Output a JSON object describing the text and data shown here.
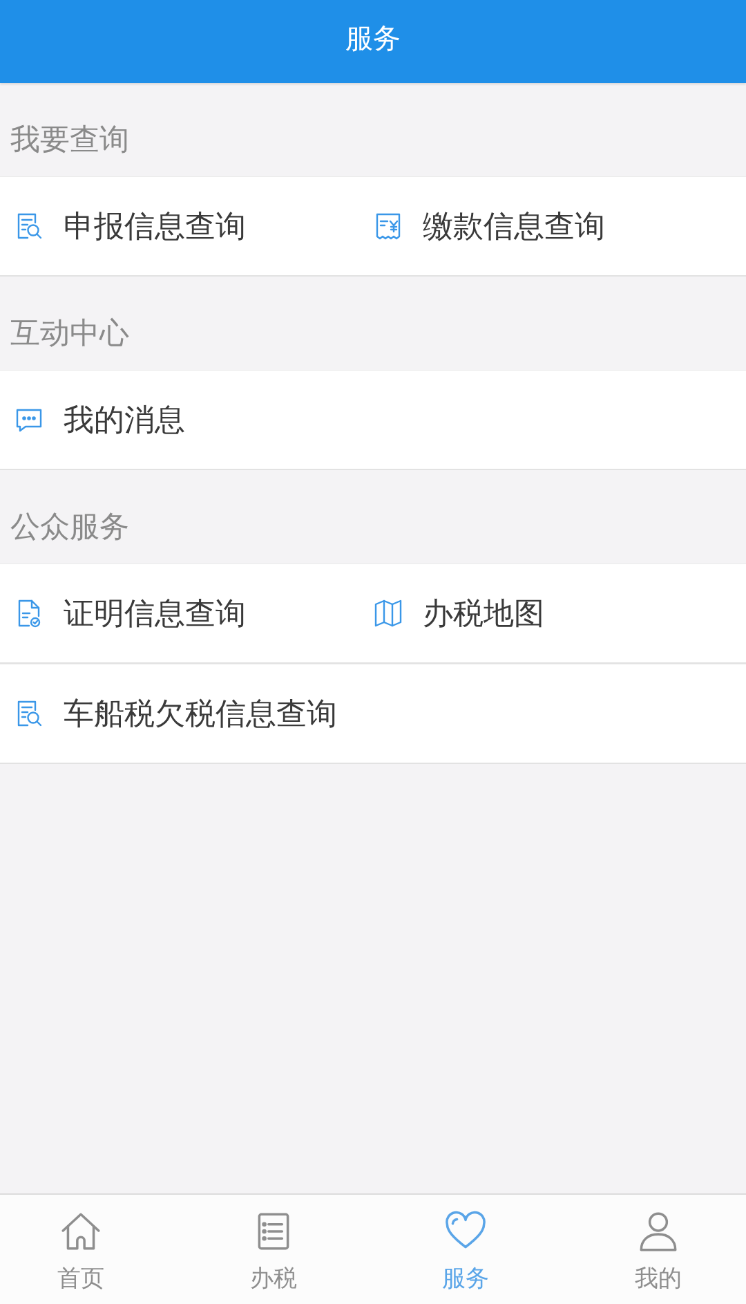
{
  "header": {
    "title": "服务"
  },
  "sections": [
    {
      "title": "我要查询",
      "rows": [
        {
          "items": [
            {
              "kind": "query",
              "label": "申报信息查询"
            },
            {
              "kind": "payment",
              "label": "缴款信息查询"
            }
          ]
        }
      ]
    },
    {
      "title": "互动中心",
      "rows": [
        {
          "items": [
            {
              "kind": "message",
              "label": "我的消息"
            }
          ]
        }
      ]
    },
    {
      "title": "公众服务",
      "rows": [
        {
          "items": [
            {
              "kind": "certificate",
              "label": "证明信息查询"
            },
            {
              "kind": "map",
              "label": "办税地图"
            }
          ]
        },
        {
          "items": [
            {
              "kind": "query",
              "label": "车船税欠税信息查询"
            }
          ]
        }
      ]
    }
  ],
  "tabs": [
    {
      "kind": "home",
      "label": "首页",
      "selected": false
    },
    {
      "kind": "tax",
      "label": "办税",
      "selected": false
    },
    {
      "kind": "service",
      "label": "服务",
      "selected": true
    },
    {
      "kind": "mine",
      "label": "我的",
      "selected": false
    }
  ]
}
